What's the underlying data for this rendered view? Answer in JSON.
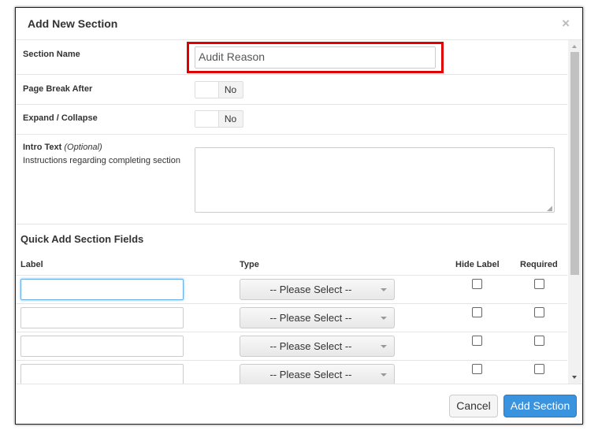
{
  "modal": {
    "title": "Add New Section",
    "close_glyph": "×"
  },
  "form": {
    "section_name": {
      "label": "Section Name",
      "value": "Audit Reason"
    },
    "page_break": {
      "label": "Page Break After",
      "value": "No"
    },
    "expand_collapse": {
      "label": "Expand / Collapse",
      "value": "No"
    },
    "intro_text": {
      "label": "Intro Text",
      "optional": "(Optional)",
      "help": "Instructions regarding completing section",
      "value": ""
    }
  },
  "quick_add": {
    "heading": "Quick Add Section Fields",
    "columns": {
      "label": "Label",
      "type": "Type",
      "hide_label": "Hide Label",
      "required": "Required"
    },
    "rows": [
      {
        "label": "",
        "type": "-- Please Select --",
        "hide_label": false,
        "required": false
      },
      {
        "label": "",
        "type": "-- Please Select --",
        "hide_label": false,
        "required": false
      },
      {
        "label": "",
        "type": "-- Please Select --",
        "hide_label": false,
        "required": false
      },
      {
        "label": "",
        "type": "-- Please Select --",
        "hide_label": false,
        "required": false
      },
      {
        "label": "",
        "type": "",
        "hide_label": false,
        "required": false
      }
    ]
  },
  "footer": {
    "cancel_label": "Cancel",
    "add_label": "Add Section"
  },
  "colors": {
    "highlight": "#e00000",
    "primary": "#3a93de"
  }
}
